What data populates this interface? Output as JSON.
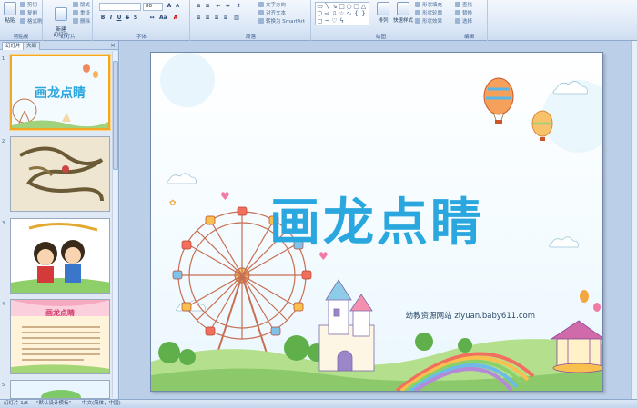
{
  "ribbon": {
    "clipboard": {
      "paste": "粘贴",
      "cut": "剪切",
      "copy": "复制",
      "format_painter": "格式刷",
      "label": "剪贴板"
    },
    "slides": {
      "new_slide": "新建\n幻灯片",
      "layout": "版式",
      "reset": "重设",
      "delete": "删除",
      "label": "幻灯片"
    },
    "font": {
      "size": "88",
      "label": "字体"
    },
    "paragraph": {
      "text_direction": "文字方向",
      "align_text": "对齐文本",
      "smartart": "转换为 SmartArt",
      "label": "段落"
    },
    "drawing": {
      "arrange": "排列",
      "quick_styles": "快速样式",
      "shape_fill": "形状填充",
      "shape_outline": "形状轮廓",
      "shape_effects": "形状效果",
      "label": "绘图"
    },
    "editing": {
      "find": "查找",
      "replace": "替换",
      "select": "选择",
      "label": "编辑"
    }
  },
  "pane": {
    "tab_slides": "幻灯片",
    "tab_outline": "大纲",
    "close": "×",
    "thumb_numbers": [
      "1",
      "2",
      "3",
      "4",
      "5"
    ],
    "thumb1_title": "画龙点睛",
    "thumb4_title": "画龙点睛"
  },
  "slide": {
    "title": "画龙点睛",
    "caption": "幼教资源网站  ziyuan.baby611.com"
  },
  "statusbar": {
    "slide_indicator": "幻灯片 1/6",
    "theme": "\"默认设计模板\"",
    "language": "中文(简体，中国)"
  },
  "colors": {
    "title_blue": "#2aa7de",
    "selection_orange": "#f5a623",
    "ribbon_text": "#1e395b"
  }
}
